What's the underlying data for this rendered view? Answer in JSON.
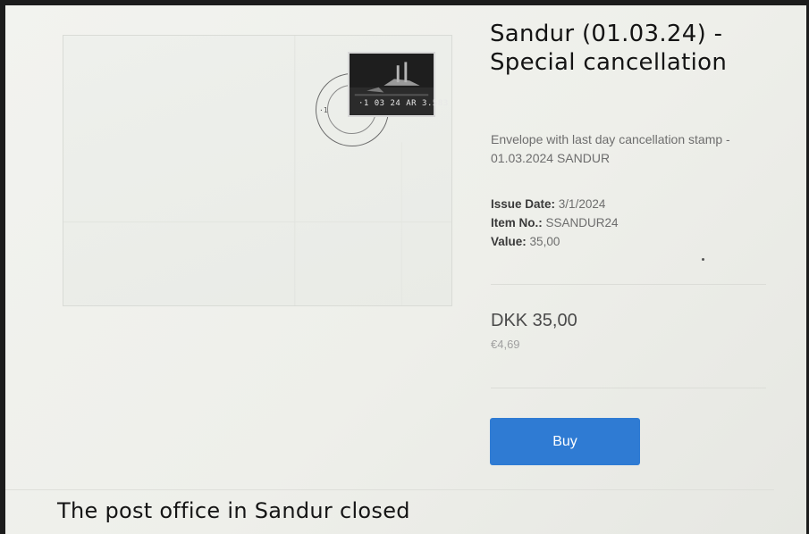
{
  "product": {
    "title": "Sandur (01.03.24) - Special cancellation",
    "description": "Envelope with last day cancellation stamp - 01.03.2024 SANDUR",
    "meta": {
      "issue_date_label": "Issue Date:",
      "issue_date_value": "3/1/2024",
      "item_no_label": "Item No.:",
      "item_no_value": "SSANDUR24",
      "value_label": "Value:",
      "value_value": "35,00"
    },
    "price_dkk": "DKK 35,00",
    "price_eur": "€4,69",
    "buy_label": "Buy",
    "stamp_text": "·1 03 24 AR 3.583",
    "postmark_date": "·1"
  },
  "section": {
    "heading": "The post office in Sandur closed"
  },
  "colors": {
    "buy_button": "#2f7bd3",
    "title_text": "#141414",
    "body_text": "#6d6d6d"
  }
}
